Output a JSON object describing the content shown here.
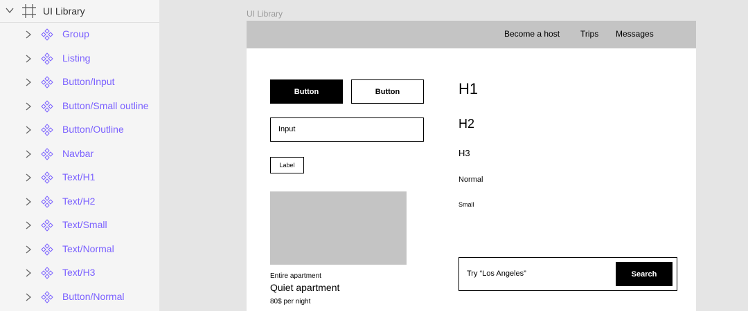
{
  "layers": {
    "root": {
      "label": "UI Library"
    },
    "items": [
      {
        "label": "Group"
      },
      {
        "label": "Listing"
      },
      {
        "label": "Button/Input"
      },
      {
        "label": "Button/Small outline"
      },
      {
        "label": "Button/Outline"
      },
      {
        "label": "Navbar"
      },
      {
        "label": "Text/H1"
      },
      {
        "label": "Text/H2"
      },
      {
        "label": "Text/Small"
      },
      {
        "label": "Text/Normal"
      },
      {
        "label": "Text/H3"
      },
      {
        "label": "Button/Normal"
      }
    ]
  },
  "canvas": {
    "frame_title": "UI Library",
    "navbar": {
      "links": [
        "Become a host",
        "Trips",
        "Messages"
      ]
    },
    "buttons": {
      "solid": "Button",
      "outline": "Button"
    },
    "input": {
      "value": "Input"
    },
    "label_box": "Label",
    "listing": {
      "type": "Entire apartment",
      "title": "Quiet apartment",
      "price": "80$ per night"
    },
    "text_styles": {
      "h1": "H1",
      "h2": "H2",
      "h3": "H3",
      "normal": "Normal",
      "small": "Small"
    },
    "search": {
      "placeholder": "Try “Los Angeles”",
      "button": "Search"
    }
  },
  "colors": {
    "layer_text": "#7b61ff",
    "panel_bg": "#f5f5f5",
    "canvas_bg": "#e5e5e5",
    "navbar_bg": "#c4c4c4",
    "image_placeholder": "#c4c4c4"
  },
  "icons": {
    "root_expand": "chevron-down-icon",
    "root_type": "frame-icon",
    "item_expand": "chevron-right-icon",
    "item_type": "component-icon"
  }
}
